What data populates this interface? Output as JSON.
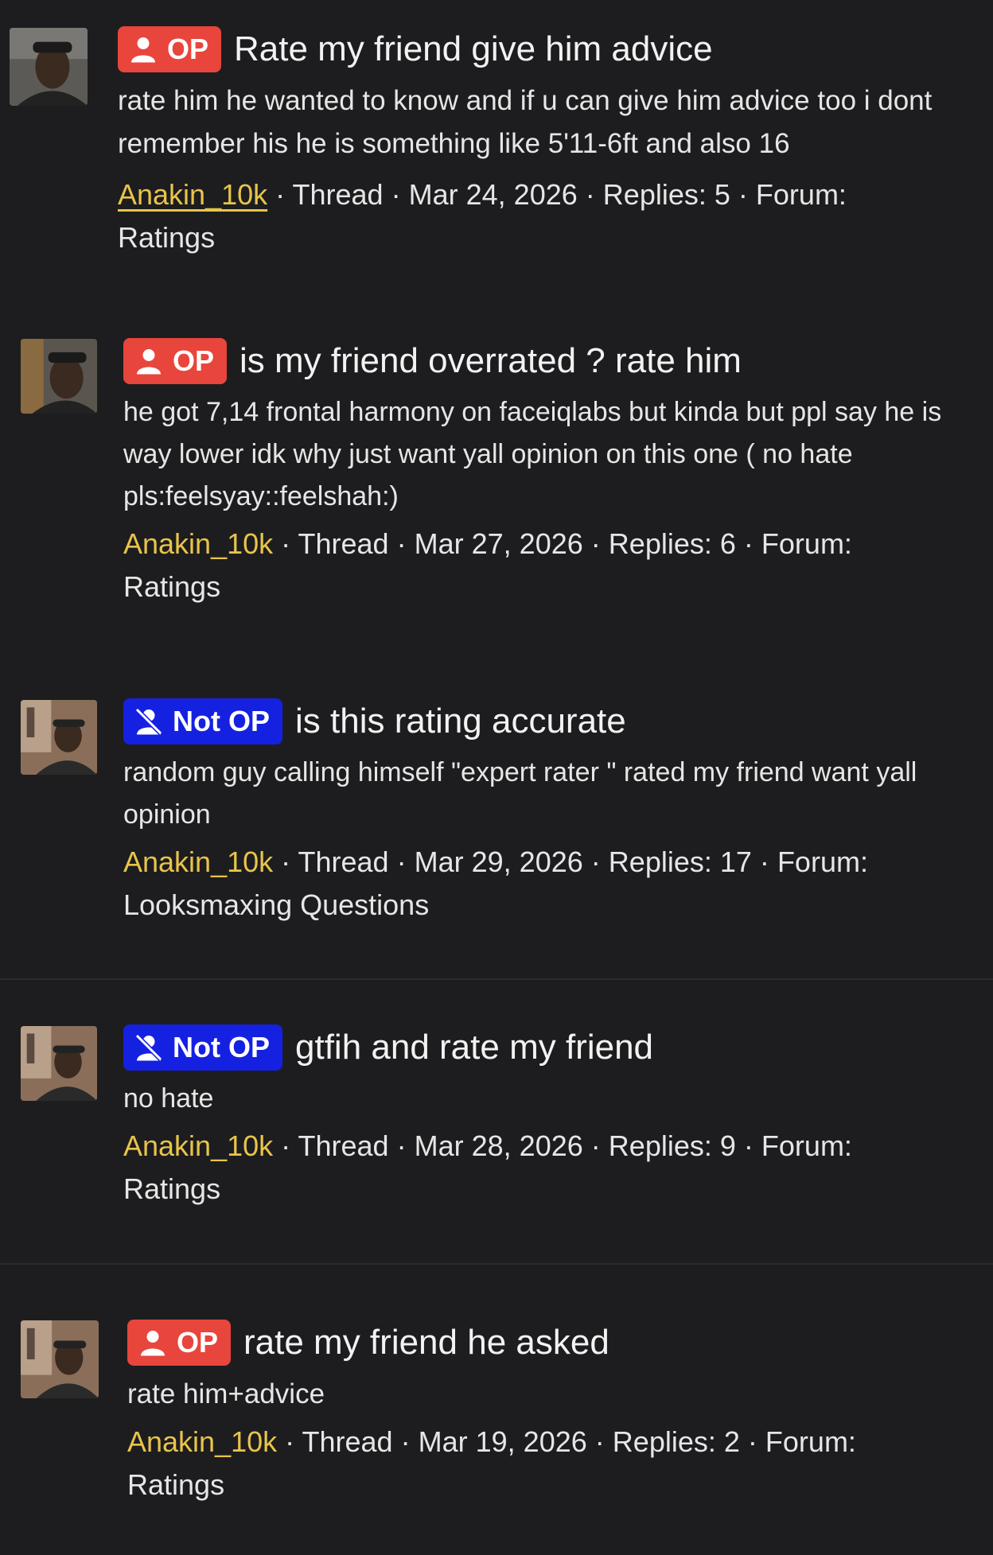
{
  "threads": [
    {
      "badge": "OP",
      "badge_type": "op",
      "title": "Rate my friend give him advice",
      "snippet": "rate him he wanted to know and if u can give him advice too i dont remember his he is something like 5'11-6ft and also 16",
      "author": "Anakin_10k",
      "type": "Thread",
      "date": "Mar 24, 2026",
      "replies_label": "Replies: 5",
      "forum_label": "Forum:",
      "forum": "Ratings"
    },
    {
      "badge": "OP",
      "badge_type": "op",
      "title": "is my friend overrated ? rate him",
      "snippet": "he got 7,14 frontal harmony on faceiqlabs but kinda but ppl say he is way lower idk why just want yall opinion on this one ( no hate pls:feelsyay::feelshah:)",
      "author": "Anakin_10k",
      "type": "Thread",
      "date": "Mar 27, 2026",
      "replies_label": "Replies: 6",
      "forum_label": "Forum:",
      "forum": "Ratings"
    },
    {
      "badge": "Not OP",
      "badge_type": "notop",
      "title": "is this rating accurate",
      "snippet": "random guy calling himself \"expert rater \" rated my friend want yall opinion",
      "author": "Anakin_10k",
      "type": "Thread",
      "date": "Mar 29, 2026",
      "replies_label": "Replies: 17",
      "forum_label": "Forum:",
      "forum": "Looksmaxing Questions"
    },
    {
      "badge": "Not OP",
      "badge_type": "notop",
      "title": "gtfih and rate my friend",
      "snippet": "no hate",
      "author": "Anakin_10k",
      "type": "Thread",
      "date": "Mar 28, 2026",
      "replies_label": "Replies: 9",
      "forum_label": "Forum:",
      "forum": "Ratings"
    },
    {
      "badge": "OP",
      "badge_type": "op",
      "title": "rate my friend he asked",
      "snippet": "rate him+advice",
      "author": "Anakin_10k",
      "type": "Thread",
      "date": "Mar 19, 2026",
      "replies_label": "Replies: 2",
      "forum_label": "Forum:",
      "forum": "Ratings"
    }
  ],
  "separator": "·",
  "colors": {
    "background": "#1d1d1f",
    "op_badge": "#e8453c",
    "not_op_badge": "#1521e0",
    "author": "#e8c44a",
    "text": "#e6e6e6"
  }
}
